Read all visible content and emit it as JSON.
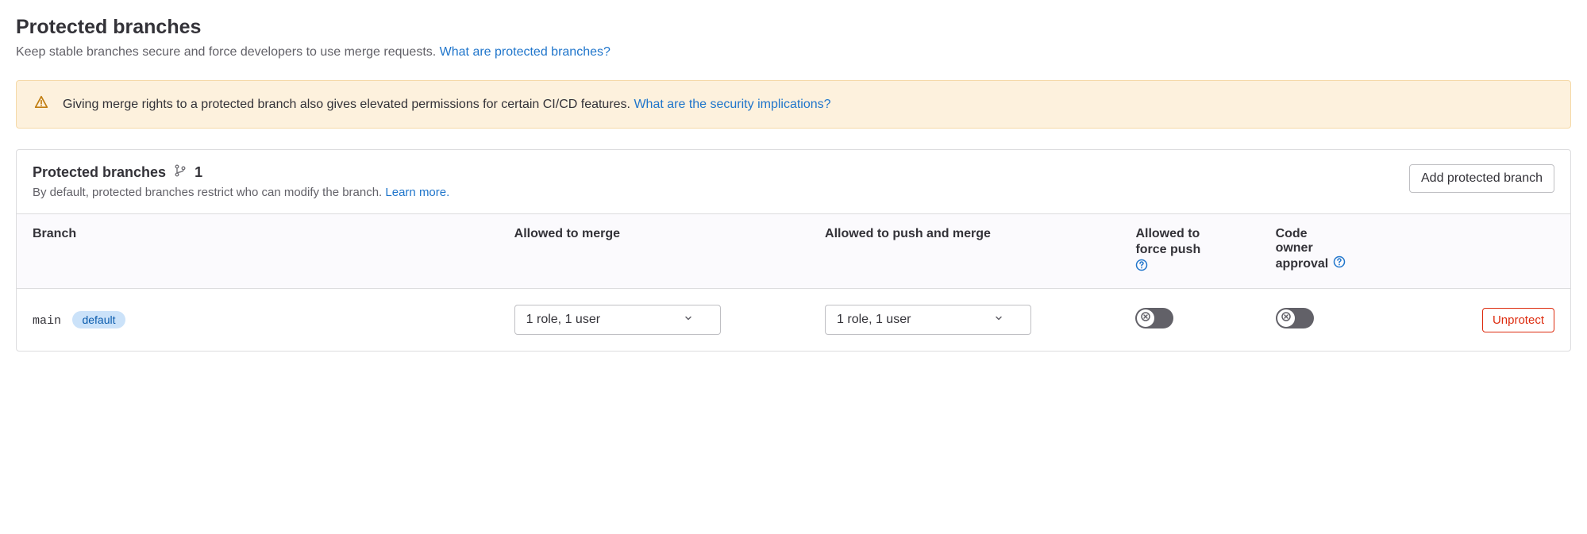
{
  "header": {
    "title": "Protected branches",
    "description": "Keep stable branches secure and force developers to use merge requests.",
    "help_link": "What are protected branches?"
  },
  "alert": {
    "text": "Giving merge rights to a protected branch also gives elevated permissions for certain CI/CD features.",
    "help_link": "What are the security implications?"
  },
  "card": {
    "title": "Protected branches",
    "count": "1",
    "subtitle": "By default, protected branches restrict who can modify the branch.",
    "learn_more": "Learn more.",
    "add_button": "Add protected branch"
  },
  "table": {
    "headers": {
      "branch": "Branch",
      "allowed_merge": "Allowed to merge",
      "allowed_push": "Allowed to push and merge",
      "force_push_l1": "Allowed to",
      "force_push_l2": "force push",
      "code_owner_l1": "Code",
      "code_owner_l2": "owner",
      "code_owner_l3": "approval"
    },
    "rows": [
      {
        "branch": "main",
        "badge": "default",
        "merge_select": "1 role, 1 user",
        "push_select": "1 role, 1 user",
        "force_push": false,
        "code_owner": false,
        "action": "Unprotect"
      }
    ]
  }
}
